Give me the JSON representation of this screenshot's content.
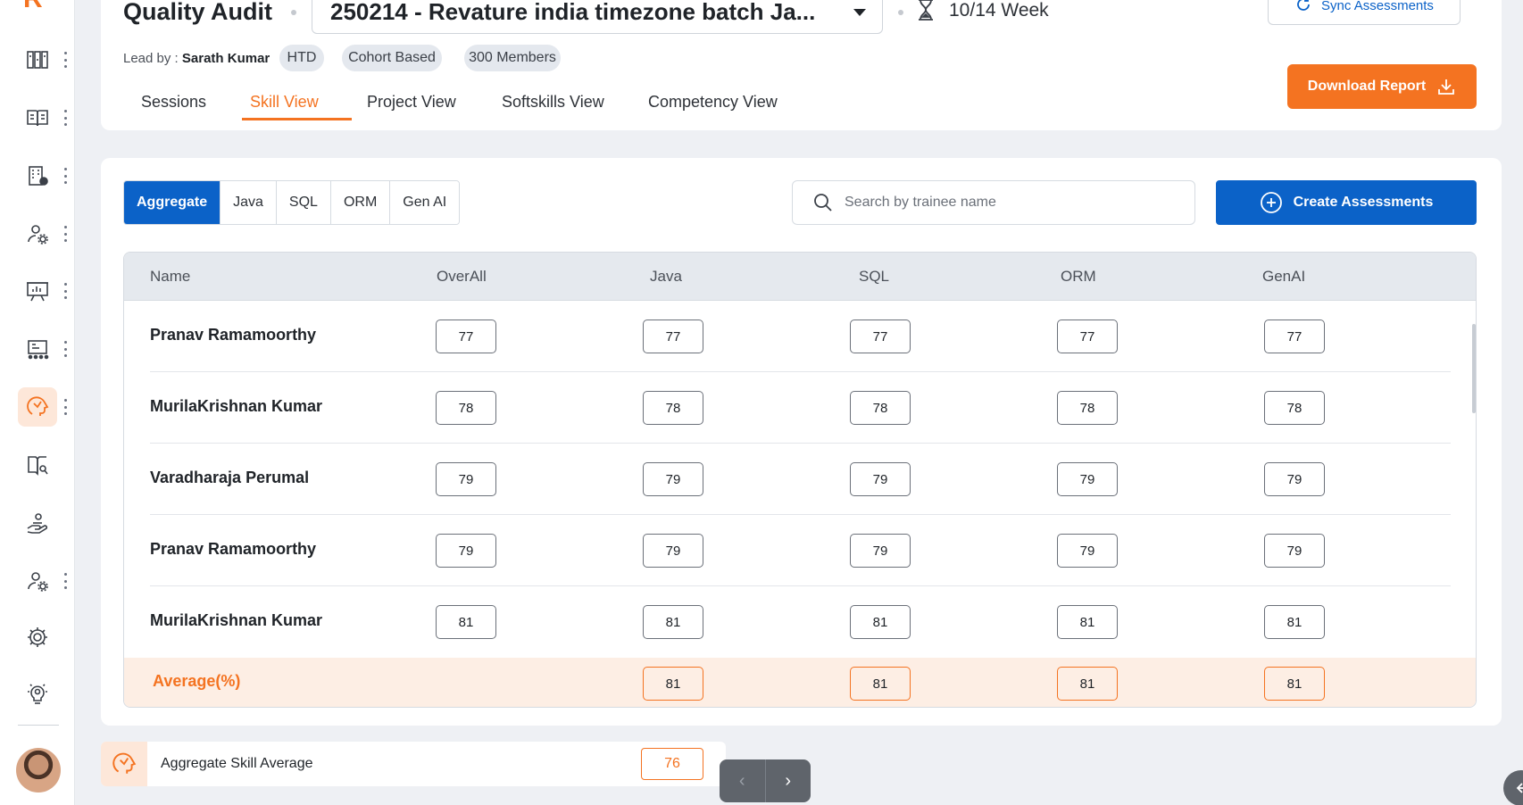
{
  "header": {
    "title": "Quality Audit",
    "batch": "250214 - Revature india timezone batch Ja...",
    "week": "10/14 Week",
    "sync_label": "Sync Assessments",
    "lead_prefix": "Lead by :",
    "lead_name": "Sarath Kumar",
    "chips": [
      "HTD",
      "Cohort Based",
      "300 Members"
    ],
    "download_label": "Download Report",
    "tabs": [
      "Sessions",
      "Skill View",
      "Project View",
      "Softskills View",
      "Competency View"
    ],
    "active_tab": "Skill View"
  },
  "filters": {
    "items": [
      "Aggregate",
      "Java",
      "SQL",
      "ORM",
      "Gen AI"
    ],
    "active": "Aggregate"
  },
  "search": {
    "placeholder": "Search by trainee name"
  },
  "create_label": "Create Assessments",
  "table": {
    "columns": [
      "Name",
      "OverAll",
      "Java",
      "SQL",
      "ORM",
      "GenAI"
    ],
    "rows": [
      {
        "name": "Pranav Ramamoorthy",
        "scores": [
          "77",
          "77",
          "77",
          "77",
          "77"
        ]
      },
      {
        "name": "MurilaKrishnan Kumar",
        "scores": [
          "78",
          "78",
          "78",
          "78",
          "78"
        ]
      },
      {
        "name": "Varadharaja Perumal",
        "scores": [
          "79",
          "79",
          "79",
          "79",
          "79"
        ]
      },
      {
        "name": "Pranav Ramamoorthy",
        "scores": [
          "79",
          "79",
          "79",
          "79",
          "79"
        ]
      },
      {
        "name": "MurilaKrishnan Kumar",
        "scores": [
          "81",
          "81",
          "81",
          "81",
          "81"
        ]
      }
    ],
    "average": {
      "label": "Average(%)",
      "scores": [
        "81",
        "81",
        "81",
        "81"
      ]
    }
  },
  "footer": {
    "label": "Aggregate Skill Average",
    "value": "76"
  },
  "pager": {
    "prev": "‹",
    "next": "›"
  },
  "colors": {
    "accent": "#f47321",
    "primary": "#0b62c8",
    "background": "#eef0f4"
  },
  "sidebar_icons": [
    "dashboard-icon",
    "book-icon",
    "building-icon",
    "user-settings-icon",
    "presentation-icon",
    "schedule-icon",
    "skill-icon",
    "reading-icon",
    "hand-user-icon",
    "user-settings-icon",
    "gear-icon",
    "lightbulb-gear-icon"
  ]
}
